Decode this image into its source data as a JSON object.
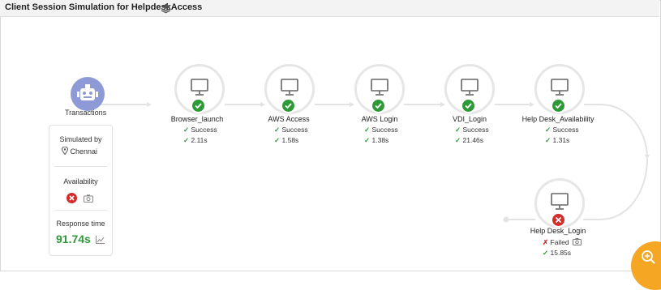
{
  "header": {
    "title": "Client Session Simulation for HelpdeskAccess",
    "layers_icon": "layers-icon"
  },
  "start": {
    "label": "Transactions",
    "icon": "robot-icon"
  },
  "steps": [
    {
      "name": "Browser_launch",
      "status": "Success",
      "time": "2.11s",
      "icon": "monitor-icon",
      "state": "ok"
    },
    {
      "name": "AWS Access",
      "status": "Success",
      "time": "1.58s",
      "icon": "monitor-icon",
      "state": "ok"
    },
    {
      "name": "AWS Login",
      "status": "Success",
      "time": "1.38s",
      "icon": "monitor-icon",
      "state": "ok"
    },
    {
      "name": "VDI_Login",
      "status": "Success",
      "time": "21.46s",
      "icon": "monitor-icon",
      "state": "ok"
    },
    {
      "name": "Help Desk_Availability",
      "status": "Success",
      "time": "1.31s",
      "icon": "monitor-icon",
      "state": "ok"
    },
    {
      "name": "Help Desk_Login",
      "status": "Failed",
      "time": "15.85s",
      "icon": "monitor-icon",
      "state": "fail"
    }
  ],
  "summary": {
    "simulated_by_label": "Simulated by",
    "location": "Chennai",
    "availability_label": "Availability",
    "response_time_label": "Response time",
    "response_time_value": "91.74s"
  },
  "colors": {
    "success": "#2e9a37",
    "failure": "#d42b2b",
    "accent": "#f5a623",
    "robot": "#8e9ad6"
  },
  "zoom_button": {
    "icon": "zoom-in-icon"
  }
}
